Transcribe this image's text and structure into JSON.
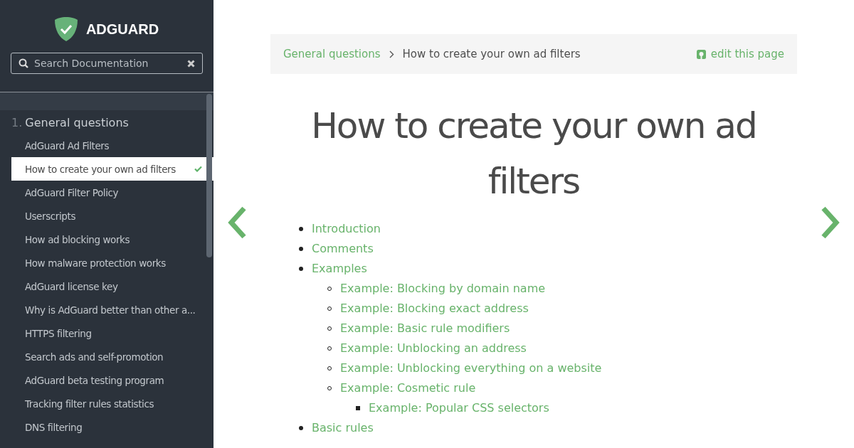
{
  "logo": {
    "text": "ADGUARD"
  },
  "search": {
    "placeholder": "Search Documentation"
  },
  "sidebar": {
    "section": {
      "number": "1.",
      "title": "General questions"
    },
    "items": [
      {
        "label": "AdGuard Ad Filters",
        "selected": false
      },
      {
        "label": "How to create your own ad filters",
        "selected": true
      },
      {
        "label": "AdGuard Filter Policy",
        "selected": false
      },
      {
        "label": "Userscripts",
        "selected": false
      },
      {
        "label": "How ad blocking works",
        "selected": false
      },
      {
        "label": "How malware protection works",
        "selected": false
      },
      {
        "label": "AdGuard license key",
        "selected": false
      },
      {
        "label": "Why is AdGuard better than other a...",
        "selected": false
      },
      {
        "label": "HTTPS filtering",
        "selected": false
      },
      {
        "label": "Search ads and self-promotion",
        "selected": false
      },
      {
        "label": "AdGuard beta testing program",
        "selected": false
      },
      {
        "label": "Tracking filter rules statistics",
        "selected": false
      },
      {
        "label": "DNS filtering",
        "selected": false
      }
    ]
  },
  "breadcrumb": {
    "parent": "General questions",
    "current": "How to create your own ad filters",
    "edit": "edit this page"
  },
  "title": "How to create your own ad filters",
  "toc": [
    {
      "label": "Introduction"
    },
    {
      "label": "Comments"
    },
    {
      "label": "Examples",
      "children": [
        {
          "label": "Example: Blocking by domain name"
        },
        {
          "label": "Example: Blocking exact address"
        },
        {
          "label": "Example: Basic rule modifiers"
        },
        {
          "label": "Example: Unblocking an address"
        },
        {
          "label": "Example: Unblocking everything on a website"
        },
        {
          "label": "Example: Cosmetic rule",
          "children": [
            {
              "label": "Example: Popular CSS selectors"
            }
          ]
        }
      ]
    },
    {
      "label": "Basic rules"
    }
  ]
}
